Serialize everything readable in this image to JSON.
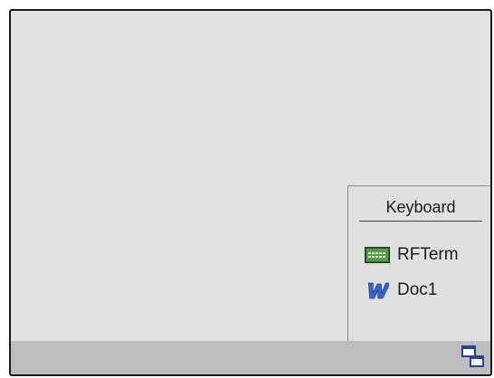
{
  "menu": {
    "title": "Keyboard",
    "items": [
      {
        "label": "RFTerm",
        "icon": "keyboard-icon"
      },
      {
        "label": "Doc1",
        "icon": "word-doc-icon"
      }
    ]
  },
  "taskbar": {
    "switch_icon": "window-switch-icon"
  },
  "colors": {
    "screen_bg": "#e2e2e2",
    "taskbar_bg": "#bdbdbd",
    "keyboard_icon": "#3f7a3f",
    "word_icon": "#2b4fb0",
    "switch_icon": "#2c3f96"
  }
}
